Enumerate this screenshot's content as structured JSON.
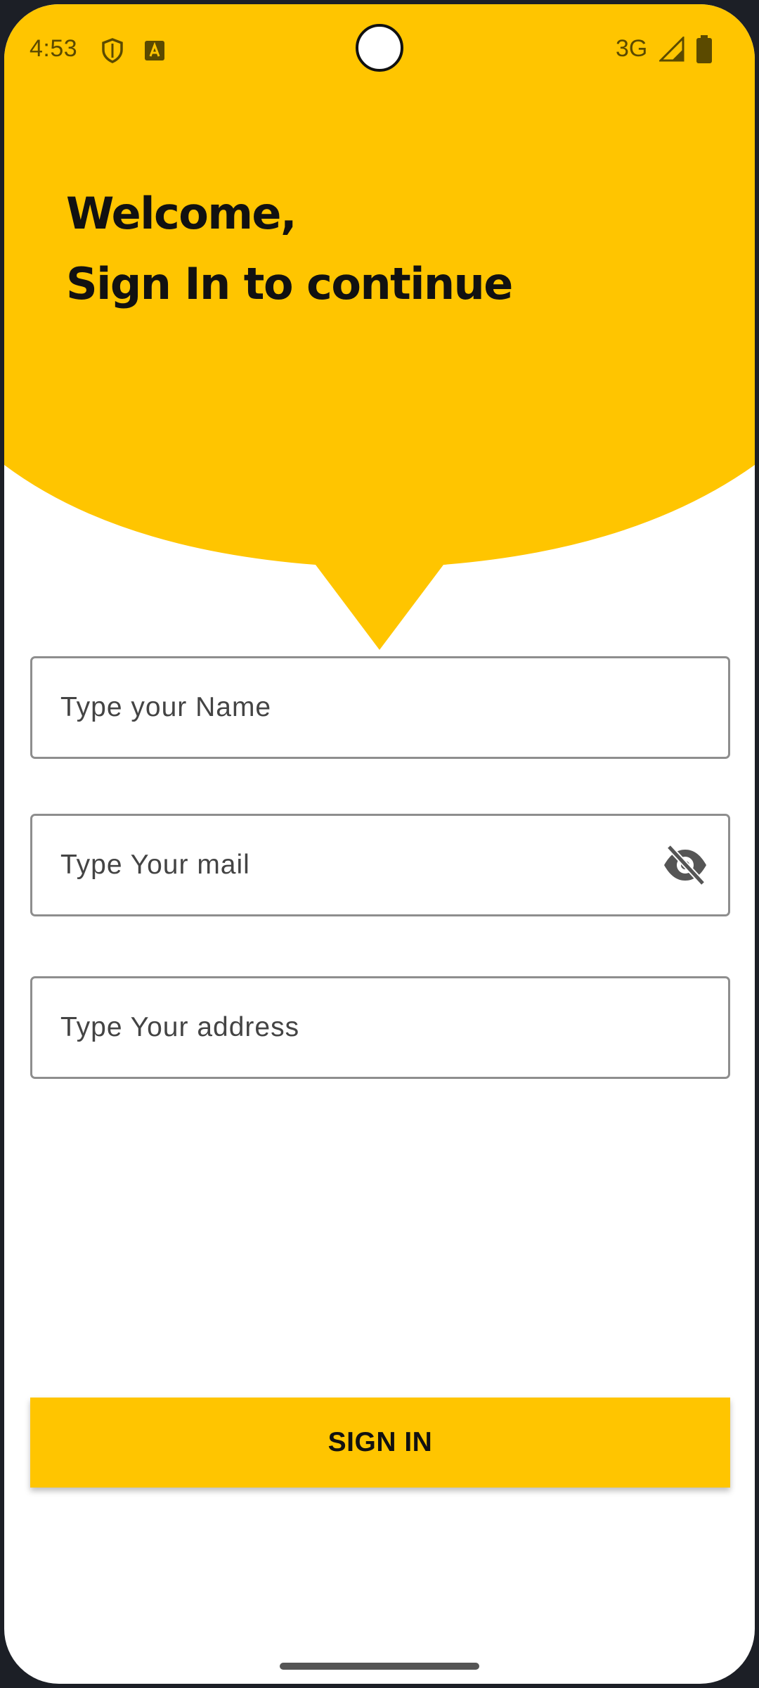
{
  "status_bar": {
    "time": "4:53",
    "network": "3G",
    "icons": [
      "shield-icon",
      "font-a-icon",
      "signal-icon",
      "battery-icon"
    ]
  },
  "header": {
    "line1": "Welcome,",
    "line2": "Sign In to continue"
  },
  "form": {
    "name_placeholder": "Type your Name",
    "mail_placeholder": "Type Your mail",
    "address_placeholder": "Type Your address",
    "mail_toggle_icon": "eye-off-icon"
  },
  "actions": {
    "signin_label": "SIGN IN"
  },
  "colors": {
    "accent": "#ffc500",
    "status_text": "#5b4a00",
    "field_border": "#8e8e8e"
  }
}
